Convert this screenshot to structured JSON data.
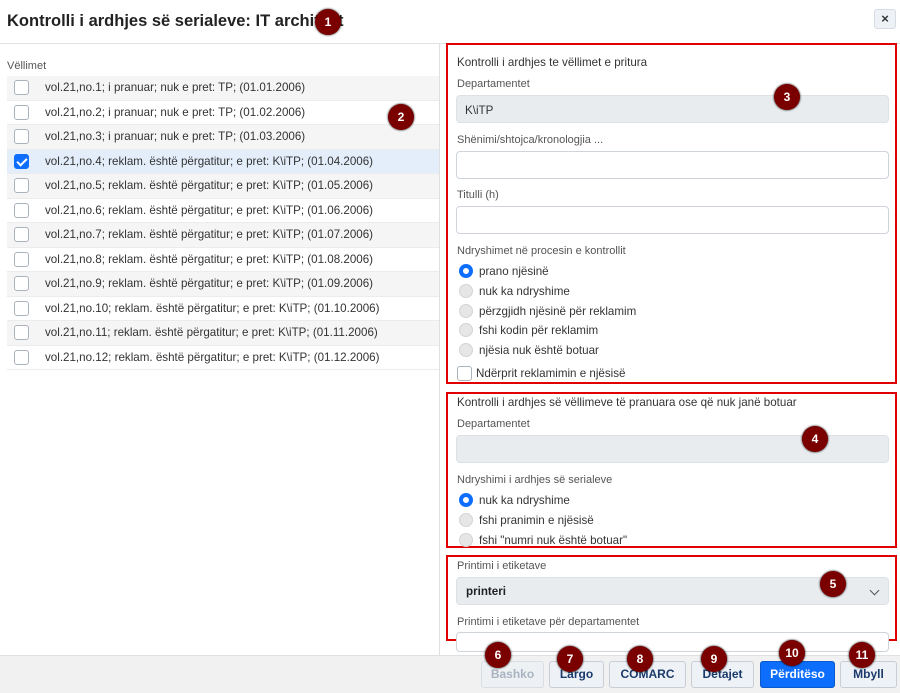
{
  "window": {
    "title": "Kontrolli i ardhjes së serialeve: IT architect",
    "close_label": "×"
  },
  "volumes": {
    "label": "Vëllimet",
    "items": [
      {
        "text": "vol.21,no.1; i pranuar; nuk e pret: TP; (01.01.2006)",
        "checked": false
      },
      {
        "text": "vol.21,no.2; i pranuar; nuk e pret: TP; (01.02.2006)",
        "checked": false
      },
      {
        "text": "vol.21,no.3; i pranuar; nuk e pret: TP; (01.03.2006)",
        "checked": false
      },
      {
        "text": "vol.21,no.4; reklam. është përgatitur; e pret: K\\iTP; (01.04.2006)",
        "checked": true
      },
      {
        "text": "vol.21,no.5; reklam. është përgatitur; e pret: K\\iTP; (01.05.2006)",
        "checked": false
      },
      {
        "text": "vol.21,no.6; reklam. është përgatitur; e pret: K\\iTP; (01.06.2006)",
        "checked": false
      },
      {
        "text": "vol.21,no.7; reklam. është përgatitur; e pret: K\\iTP; (01.07.2006)",
        "checked": false
      },
      {
        "text": "vol.21,no.8; reklam. është përgatitur; e pret: K\\iTP; (01.08.2006)",
        "checked": false
      },
      {
        "text": "vol.21,no.9; reklam. është përgatitur; e pret: K\\iTP; (01.09.2006)",
        "checked": false
      },
      {
        "text": "vol.21,no.10; reklam. është përgatitur; e pret: K\\iTP; (01.10.2006)",
        "checked": false
      },
      {
        "text": "vol.21,no.11; reklam. është përgatitur; e pret: K\\iTP; (01.11.2006)",
        "checked": false
      },
      {
        "text": "vol.21,no.12; reklam. është përgatitur; e pret: K\\iTP; (01.12.2006)",
        "checked": false
      }
    ]
  },
  "section1": {
    "title": "Kontrolli i ardhjes te vëllimet e pritura",
    "department_label": "Departamentet",
    "department_value": "K\\iTP",
    "note_label": "Shënimi/shtojca/kronologjia ...",
    "note_value": "",
    "title_label": "Titulli (h)",
    "title_value": "",
    "changes_label": "Ndryshimet në procesin e kontrollit",
    "options": [
      "prano njësinë",
      "nuk ka ndryshime",
      "përzgjidh njësinë për reklamim",
      "fshi kodin për reklamim",
      "njësia nuk është botuar"
    ],
    "selected_option": 0,
    "interrupt_label": "Ndërprit reklamimin e njësisë"
  },
  "section2": {
    "title": "Kontrolli i ardhjes së vëllimeve të pranuara ose që nuk janë botuar",
    "department_label": "Departamentet",
    "department_value": "",
    "changes_label": "Ndryshimi i ardhjes së serialeve",
    "options": [
      "nuk ka ndryshime",
      "fshi pranimin e njësisë",
      "fshi \"numri nuk është botuar\""
    ],
    "selected_option": 0
  },
  "section3": {
    "print_label": "Printimi i etiketave",
    "printer_value": "printeri",
    "dept_print_label": "Printimi i etiketave për departamentet"
  },
  "footer": {
    "buttons": [
      {
        "label": "Bashko",
        "state": "disabled"
      },
      {
        "label": "Largo",
        "state": "normal"
      },
      {
        "label": "COMARC",
        "state": "normal"
      },
      {
        "label": "Detajet",
        "state": "normal"
      },
      {
        "label": "Përditëso",
        "state": "primary"
      },
      {
        "label": "Mbyll",
        "state": "normal"
      }
    ]
  },
  "badges": [
    "1",
    "2",
    "3",
    "4",
    "5",
    "6",
    "7",
    "8",
    "9",
    "10",
    "11"
  ],
  "colors": {
    "accent": "#0d6efd",
    "badge": "#7a0000",
    "highlight_border": "#e00000"
  },
  "icons": {
    "close": "close-icon",
    "checkbox_checked": "check-icon",
    "select_chevron": "chevron-down-icon"
  }
}
